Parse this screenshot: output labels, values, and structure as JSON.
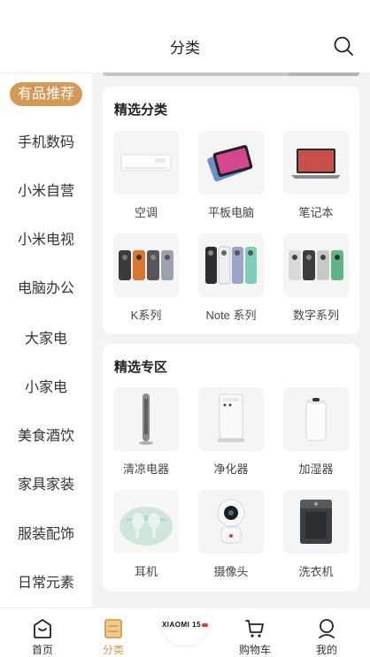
{
  "header": {
    "title": "分类"
  },
  "sidebar": {
    "items": [
      {
        "label": "有品推荐",
        "active": true
      },
      {
        "label": "手机数码"
      },
      {
        "label": "小米自营"
      },
      {
        "label": "小米电视"
      },
      {
        "label": "电脑办公"
      },
      {
        "label": "大家电"
      },
      {
        "label": "小家电"
      },
      {
        "label": "美食酒饮"
      },
      {
        "label": "家具家装"
      },
      {
        "label": "服装配饰"
      },
      {
        "label": "日常元素"
      }
    ]
  },
  "sections": [
    {
      "title": "精选分类",
      "items": [
        {
          "label": "空调",
          "icon": "air-conditioner-icon"
        },
        {
          "label": "平板电脑",
          "icon": "tablet-icon"
        },
        {
          "label": "笔记本",
          "icon": "laptop-icon"
        },
        {
          "label": "K系列",
          "icon": "phone-icon"
        },
        {
          "label": "Note 系列",
          "icon": "phone-icon"
        },
        {
          "label": "数字系列",
          "icon": "phone-icon"
        }
      ]
    },
    {
      "title": "精选专区",
      "items": [
        {
          "label": "清凉电器",
          "icon": "tower-fan-icon"
        },
        {
          "label": "净化器",
          "icon": "air-purifier-icon"
        },
        {
          "label": "加湿器",
          "icon": "humidifier-icon"
        },
        {
          "label": "耳机",
          "icon": "earbuds-icon"
        },
        {
          "label": "摄像头",
          "icon": "camera-icon"
        },
        {
          "label": "洗衣机",
          "icon": "washing-machine-icon"
        }
      ]
    }
  ],
  "tabbar": {
    "tabs": [
      {
        "label": "首页",
        "icon": "home-icon"
      },
      {
        "label": "分类",
        "icon": "category-icon",
        "active": true
      },
      {
        "label": "购物车",
        "icon": "cart-icon"
      },
      {
        "label": "我的",
        "icon": "profile-icon"
      }
    ],
    "promo": {
      "text": "XIAOMI 15"
    }
  },
  "colors": {
    "accent": "#d49a55",
    "background": "#f3f3f3",
    "card": "#ffffff",
    "promo_dot": "#e03a3a"
  }
}
